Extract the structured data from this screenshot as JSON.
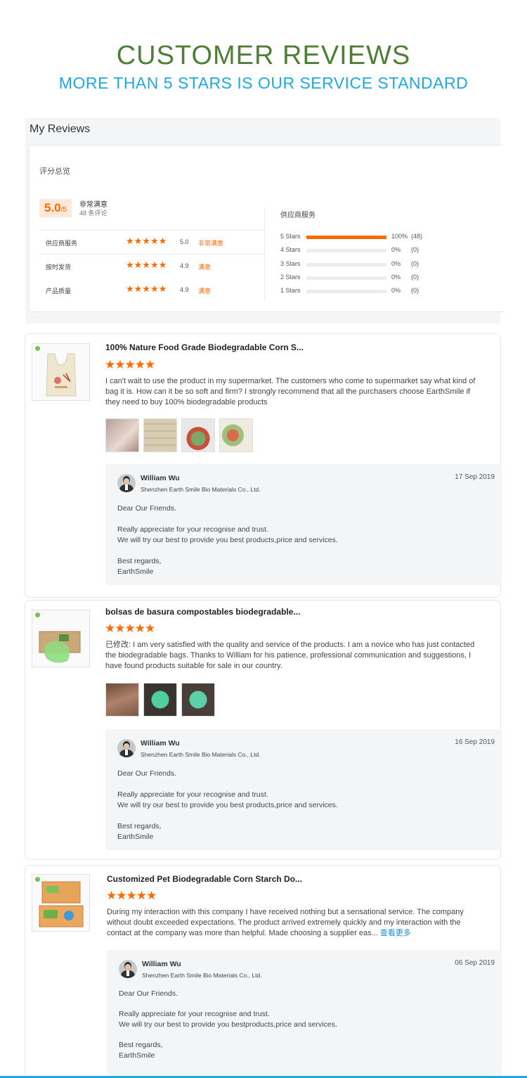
{
  "header": {
    "title": "CUSTOMER REVIEWS",
    "subtitle": "MORE THAN 5 STARS IS OUR SERVICE STANDARD"
  },
  "summary": {
    "title": "My Reviews",
    "overview_label": "评分总览",
    "score": "5.0",
    "score_max": "/5",
    "score_desc": "非常满意",
    "review_count": "48 条评论",
    "metrics": [
      {
        "label": "供应商服务",
        "stars": "★★★★★",
        "score": "5.0",
        "tag": "非常满意"
      },
      {
        "label": "按时发货",
        "stars": "★★★★★",
        "score": "4.9",
        "tag": "满意"
      },
      {
        "label": "产品质量",
        "stars": "★★★★★",
        "score": "4.9",
        "tag": "满意"
      }
    ],
    "distribution_title": "供应商服务",
    "distribution": [
      {
        "label": "5 Stars",
        "percent": "100%",
        "count": "(48)",
        "fill": 1.0
      },
      {
        "label": "4 Stars",
        "percent": "0%",
        "count": "(0)",
        "fill": 0
      },
      {
        "label": "3 Stars",
        "percent": "0%",
        "count": "(0)",
        "fill": 0
      },
      {
        "label": "2 Stars",
        "percent": "0%",
        "count": "(0)",
        "fill": 0
      },
      {
        "label": "1 Stars",
        "percent": "0%",
        "count": "(0)",
        "fill": 0
      }
    ],
    "accent_color": "#ff6a00"
  },
  "reviews": [
    {
      "product_title": "100% Nature Food Grade Biodegradable Corn S...",
      "stars": "★★★★★",
      "rating": 5,
      "text": "I can't wait to use the product in my supermarket. The customers who come to  supermarket say what kind of bag it is. How can it be so soft and firm? I strongly recommend that all the purchasers choose EarthSmile if they need to buy 100% biodegradable products",
      "more_link": "",
      "reply": {
        "name": "William Wu",
        "company": "Shenzhen Earth Smile Bio Materials Co., Ltd.",
        "date": "17 Sep 2019",
        "greeting": "Dear Our Friends.",
        "line1": "Really appreciate for your recognise and trust.",
        "line2": "We will try our best to provide you best products,price and services.",
        "closing": "Best regards,",
        "signature": "EarthSmile"
      }
    },
    {
      "product_title": "bolsas de basura compostables biodegradable...",
      "stars": "★★★★★",
      "rating": 5,
      "text": "已修改: I am very satisfied with the quality and service of the products. I am a novice who has just contacted the biodegradable bags. Thanks to William for his patience, professional communication and suggestions, I have found products suitable for sale in our country.",
      "more_link": "",
      "reply": {
        "name": "William Wu",
        "company": "Shenzhen Earth Smile Bio Materials Co., Ltd.",
        "date": "16 Sep 2019",
        "greeting": "Dear Our Friends.",
        "line1": "Really appreciate for your recognise and trust.",
        "line2": "We will try our best to provide you best products,price and services.",
        "closing": "Best regards,",
        "signature": "EarthSmile"
      }
    },
    {
      "product_title": "Customized Pet Biodegradable Corn Starch Do...",
      "stars": "★★★★★",
      "rating": 5,
      "text": "During my interaction with this company I have received nothing but a sensational service. The company without doubt exceeded expectations. The product arrived extremely quickly and my interaction with the contact at the company was more than helpful. Made choosing a supplier eas... ",
      "more_link": "查看更多",
      "reply": {
        "name": "William Wu",
        "company": "Shenzhen Earth Smile Bio Materials Co., Ltd.",
        "date": "06 Sep 2019",
        "greeting": "Dear Our Friends.",
        "line1": "Really appreciate for your recognise and trust.",
        "line2": "We will try our best to provide you bestproducts,price and services.",
        "closing": "Best regards,",
        "signature": "EarthSmile"
      }
    }
  ]
}
